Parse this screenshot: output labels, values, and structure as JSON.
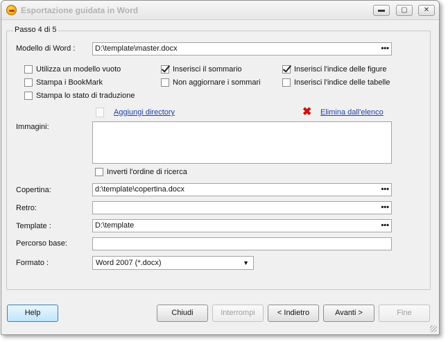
{
  "window": {
    "title": "Esportazione guidata in Word",
    "min_glyph": "▬",
    "max_glyph": "▢",
    "close_glyph": "✕"
  },
  "step": {
    "label": "Passo 4 di 5"
  },
  "template_model": {
    "label": "Modello di Word :",
    "value": "D:\\template\\master.docx"
  },
  "options": {
    "empty_model": {
      "label": "Utilizza un modello vuoto",
      "checked": false
    },
    "print_bookmark": {
      "label": "Stampa i BookMark",
      "checked": false
    },
    "print_translation_state": {
      "label": "Stampa lo stato di traduzione",
      "checked": false
    },
    "insert_summary": {
      "label": "Inserisci il sommario",
      "checked": true
    },
    "no_update_summary": {
      "label": "Non aggiornare i sommari",
      "checked": false
    },
    "insert_figures_index": {
      "label": "Inserisci l'indice delle figure",
      "checked": true
    },
    "insert_tables_index": {
      "label": "Inserisci l'indice delle tabelle",
      "checked": false
    }
  },
  "images": {
    "add_directory": "Aggiungi directory",
    "remove_from_list": "Elimina dall'elenco",
    "label": "Immagini:",
    "invert_order": {
      "label": "Inverti l'ordine di ricerca",
      "checked": false
    }
  },
  "cover": {
    "label": "Copertina:",
    "value": "d:\\template\\copertina.docx"
  },
  "back": {
    "label": "Retro:",
    "value": ""
  },
  "template": {
    "label": "Template :",
    "value": "D:\\template"
  },
  "base_path": {
    "label": "Percorso base:",
    "value": ""
  },
  "format": {
    "label": "Formato :",
    "value": "Word 2007 (*.docx)"
  },
  "browse_glyph": "•••",
  "buttons": {
    "help": "Help",
    "close": "Chiudi",
    "stop": "Interrompi",
    "back": "< Indietro",
    "next": "Avanti >",
    "finish": "Fine"
  },
  "colors": {
    "link": "#1f3fa8",
    "delete_icon": "#cc1111",
    "title_text": "#b2b2b2"
  }
}
